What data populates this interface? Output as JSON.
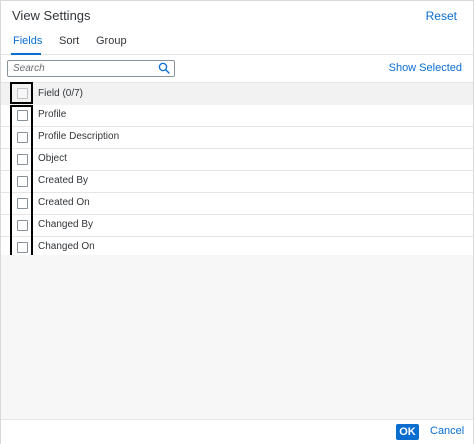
{
  "header": {
    "title": "View Settings",
    "reset_label": "Reset"
  },
  "tabs": [
    {
      "label": "Fields",
      "active": true
    },
    {
      "label": "Sort",
      "active": false
    },
    {
      "label": "Group",
      "active": false
    }
  ],
  "toolbar": {
    "search_placeholder": "Search",
    "search_value": "",
    "show_selected_label": "Show Selected"
  },
  "table": {
    "header_label": "Field (0/7)",
    "rows": [
      {
        "label": "Profile",
        "checked": false
      },
      {
        "label": "Profile Description",
        "checked": false
      },
      {
        "label": "Object",
        "checked": false
      },
      {
        "label": "Created By",
        "checked": false
      },
      {
        "label": "Created On",
        "checked": false
      },
      {
        "label": "Changed By",
        "checked": false
      },
      {
        "label": "Changed On",
        "checked": false
      }
    ]
  },
  "footer": {
    "ok_label": "OK",
    "cancel_label": "Cancel"
  },
  "colors": {
    "accent": "#0a6ed1",
    "text": "#32363a",
    "border": "#e5e5e5",
    "highlight": "#000000"
  },
  "icons": {
    "search": "search-icon"
  }
}
